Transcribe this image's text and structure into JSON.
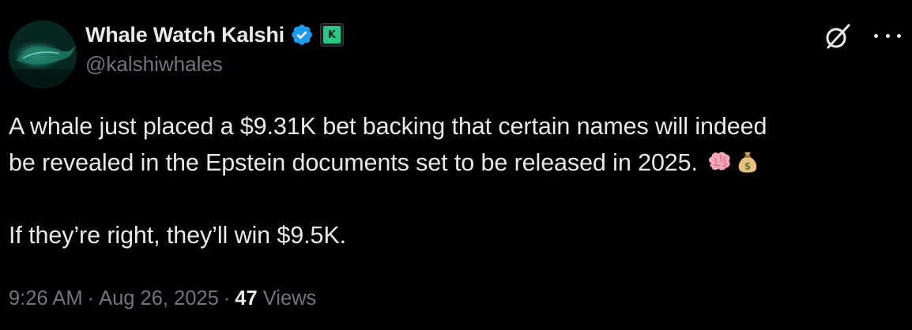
{
  "author": {
    "display_name": "Whale Watch Kalshi",
    "handle": "@kalshiwhales",
    "verified": true,
    "affiliate_badge_text": "K"
  },
  "tweet": {
    "line1": "A whale just placed a $9.31K bet backing that certain names will indeed",
    "line2": "be revealed in the Epstein documents set to be released in 2025.",
    "emojis": [
      "brain-emoji",
      "money-bag-emoji"
    ],
    "line3": "If they’re right, they’ll win $9.5K."
  },
  "meta": {
    "time": "9:26 AM",
    "separator": "·",
    "date": "Aug 26, 2025",
    "views_count": "47",
    "views_label": "Views"
  },
  "colors": {
    "background": "#000000",
    "text": "#e7e9ea",
    "secondary": "#71767b",
    "verified_blue": "#1d9bf0",
    "affiliate_green": "#28c987"
  }
}
